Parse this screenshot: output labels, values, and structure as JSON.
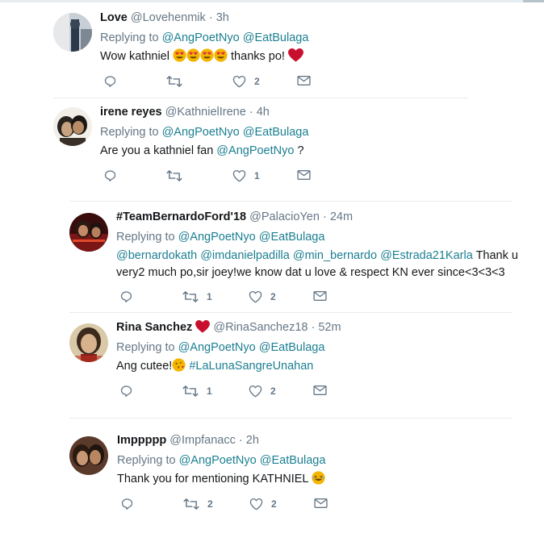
{
  "colors": {
    "link": "#1b95e0",
    "secondary": "#657786",
    "heart": "#c8102e",
    "divider": "#e6ecf0"
  },
  "replying_label": "Replying to",
  "tweets": [
    {
      "name": "Love",
      "handle": "@Lovehenmik",
      "time": "3h",
      "replying_to": [
        "@AngPoetNyo",
        "@EatBulaga"
      ],
      "text_before": "Wow kathniel",
      "text_after": "thanks po!",
      "emoji": [
        "heart-eyes-emoji",
        "heart-eyes-emoji",
        "heart-eyes-emoji",
        "heart-eyes-emoji",
        "red-heart-emoji"
      ],
      "reply_count": "",
      "retweet_count": "",
      "like_count": "2"
    },
    {
      "name": "irene reyes",
      "handle": "@KathnielIrene",
      "time": "4h",
      "replying_to": [
        "@AngPoetNyo",
        "@EatBulaga"
      ],
      "text_before": "Are you a kathniel fan",
      "text_mention": "@AngPoetNyo",
      "text_after": "?",
      "reply_count": "",
      "retweet_count": "",
      "like_count": "1"
    },
    {
      "name": "#TeamBernardoFord'18",
      "handle": "@PalacioYen",
      "time": "24m",
      "replying_to": [
        "@AngPoetNyo",
        "@EatBulaga"
      ],
      "mentions": [
        "@bernardokath",
        "@imdanielpadilla",
        "@min_bernardo",
        "@Estrada21Karla"
      ],
      "text_line1_after": "Thank u",
      "text_line2": "very2 much po,sir joey!we know dat u love & respect KN ever since<3<3<3",
      "reply_count": "",
      "retweet_count": "1",
      "like_count": "2"
    },
    {
      "name": "Rina Sanchez",
      "handle": "@RinaSanchez18",
      "time": "52m",
      "replying_to": [
        "@AngPoetNyo",
        "@EatBulaga"
      ],
      "text_before": "Ang cutee!",
      "hashtag": "#LaLunaSangreUnahan",
      "reply_count": "",
      "retweet_count": "1",
      "like_count": "2"
    },
    {
      "name": "Imppppp",
      "handle": "@Impfanacc",
      "time": "2h",
      "replying_to": [
        "@AngPoetNyo",
        "@EatBulaga"
      ],
      "text_before": "Thank you for mentioning KATHNIEL",
      "reply_count": "",
      "retweet_count": "2",
      "like_count": "2"
    }
  ],
  "dot": "·"
}
